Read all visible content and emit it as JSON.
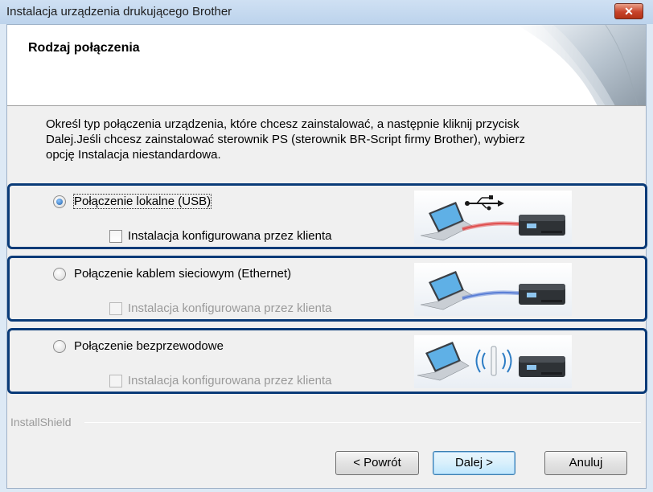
{
  "window": {
    "title": "Instalacja urządzenia drukującego Brother",
    "close_glyph": "✕"
  },
  "header": {
    "title": "Rodzaj połączenia"
  },
  "instructions": "Określ typ połączenia urządzenia, które chcesz zainstalować, a następnie kliknij przycisk\nDalej.Jeśli chcesz zainstalować sterownik PS (sterownik BR-Script firmy Brother), wybierz\nopcję Instalacja niestandardowa.",
  "options": [
    {
      "label": "Połączenie lokalne (USB)",
      "selected": true,
      "custom_install_label": "Instalacja konfigurowana przez klienta",
      "custom_install_enabled": true,
      "illustration": "usb-connection-illustration"
    },
    {
      "label": "Połączenie kablem sieciowym (Ethernet)",
      "selected": false,
      "custom_install_label": "Instalacja konfigurowana przez klienta",
      "custom_install_enabled": false,
      "illustration": "ethernet-connection-illustration"
    },
    {
      "label": "Połączenie bezprzewodowe",
      "selected": false,
      "custom_install_label": "Instalacja konfigurowana przez klienta",
      "custom_install_enabled": false,
      "illustration": "wireless-connection-illustration"
    }
  ],
  "footer": {
    "installshield": "InstallShield"
  },
  "buttons": {
    "back": "< Powrót",
    "next": "Dalej >",
    "cancel": "Anuluj"
  },
  "colors": {
    "highlight_border": "#0a3b78",
    "usb_cable": "#e05050",
    "ethernet_cable": "#5b7fd6",
    "wireless_signal": "#2c7cc4"
  }
}
